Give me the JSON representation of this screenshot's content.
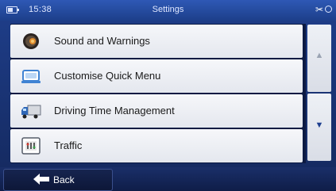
{
  "status": {
    "time": "15:38",
    "title": "Settings",
    "tools_icon": "wrench-icon"
  },
  "menu": {
    "items": [
      {
        "label": "Sound and Warnings",
        "icon": "speaker-icon"
      },
      {
        "label": "Customise Quick Menu",
        "icon": "quick-menu-icon"
      },
      {
        "label": "Driving Time Management",
        "icon": "truck-icon"
      },
      {
        "label": "Traffic",
        "icon": "traffic-icon"
      }
    ]
  },
  "scroll": {
    "up_symbol": "▲",
    "down_symbol": "▼"
  },
  "footer": {
    "back_label": "Back",
    "back_arrow": "🡐"
  },
  "colors": {
    "background": "#1f3f8c",
    "item_bg": "#eceef3",
    "accent": "#2e58b5"
  }
}
